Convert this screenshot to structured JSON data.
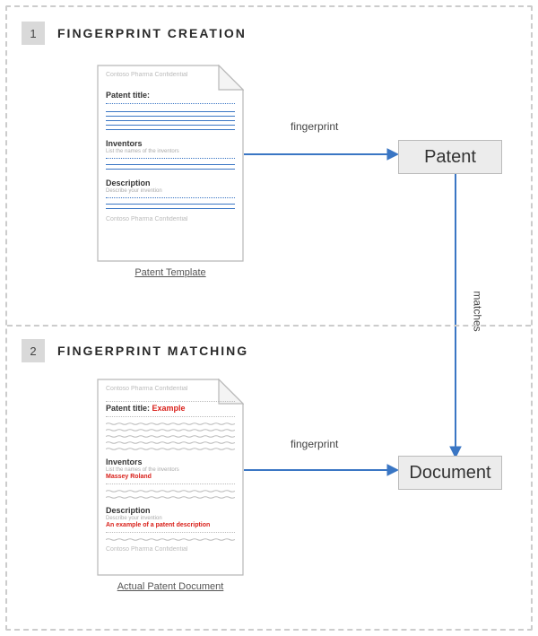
{
  "section1": {
    "number": "1",
    "title": "FINGERPRINT CREATION",
    "doc": {
      "header": "Contoso Pharma Confidential",
      "field_title": "Patent title:",
      "field_inventors": "Inventors",
      "field_inventors_sub": "List the names of the inventors",
      "field_description": "Description",
      "field_description_sub": "Describe your invention",
      "footer": "Contoso Pharma Confidential"
    },
    "doc_label": "Patent Template",
    "arrow_label": "fingerprint",
    "node": "Patent"
  },
  "matches_label": "matches",
  "section2": {
    "number": "2",
    "title": "FINGERPRINT MATCHING",
    "doc": {
      "header": "Contoso Pharma Confidential",
      "field_title_label": "Patent title:",
      "field_title_value": "Example",
      "field_inventors": "Inventors",
      "field_inventors_sub": "List the names of the inventors",
      "field_inventors_value": "Massey Roland",
      "field_description": "Description",
      "field_description_sub": "Describe your invention",
      "field_description_value": "An example of a patent description",
      "footer": "Contoso Pharma Confidential"
    },
    "doc_label": "Actual Patent Document",
    "arrow_label": "fingerprint",
    "node": "Document"
  },
  "colors": {
    "accent": "#3a76c4",
    "red": "#d9201a",
    "node_bg": "#ececec"
  }
}
